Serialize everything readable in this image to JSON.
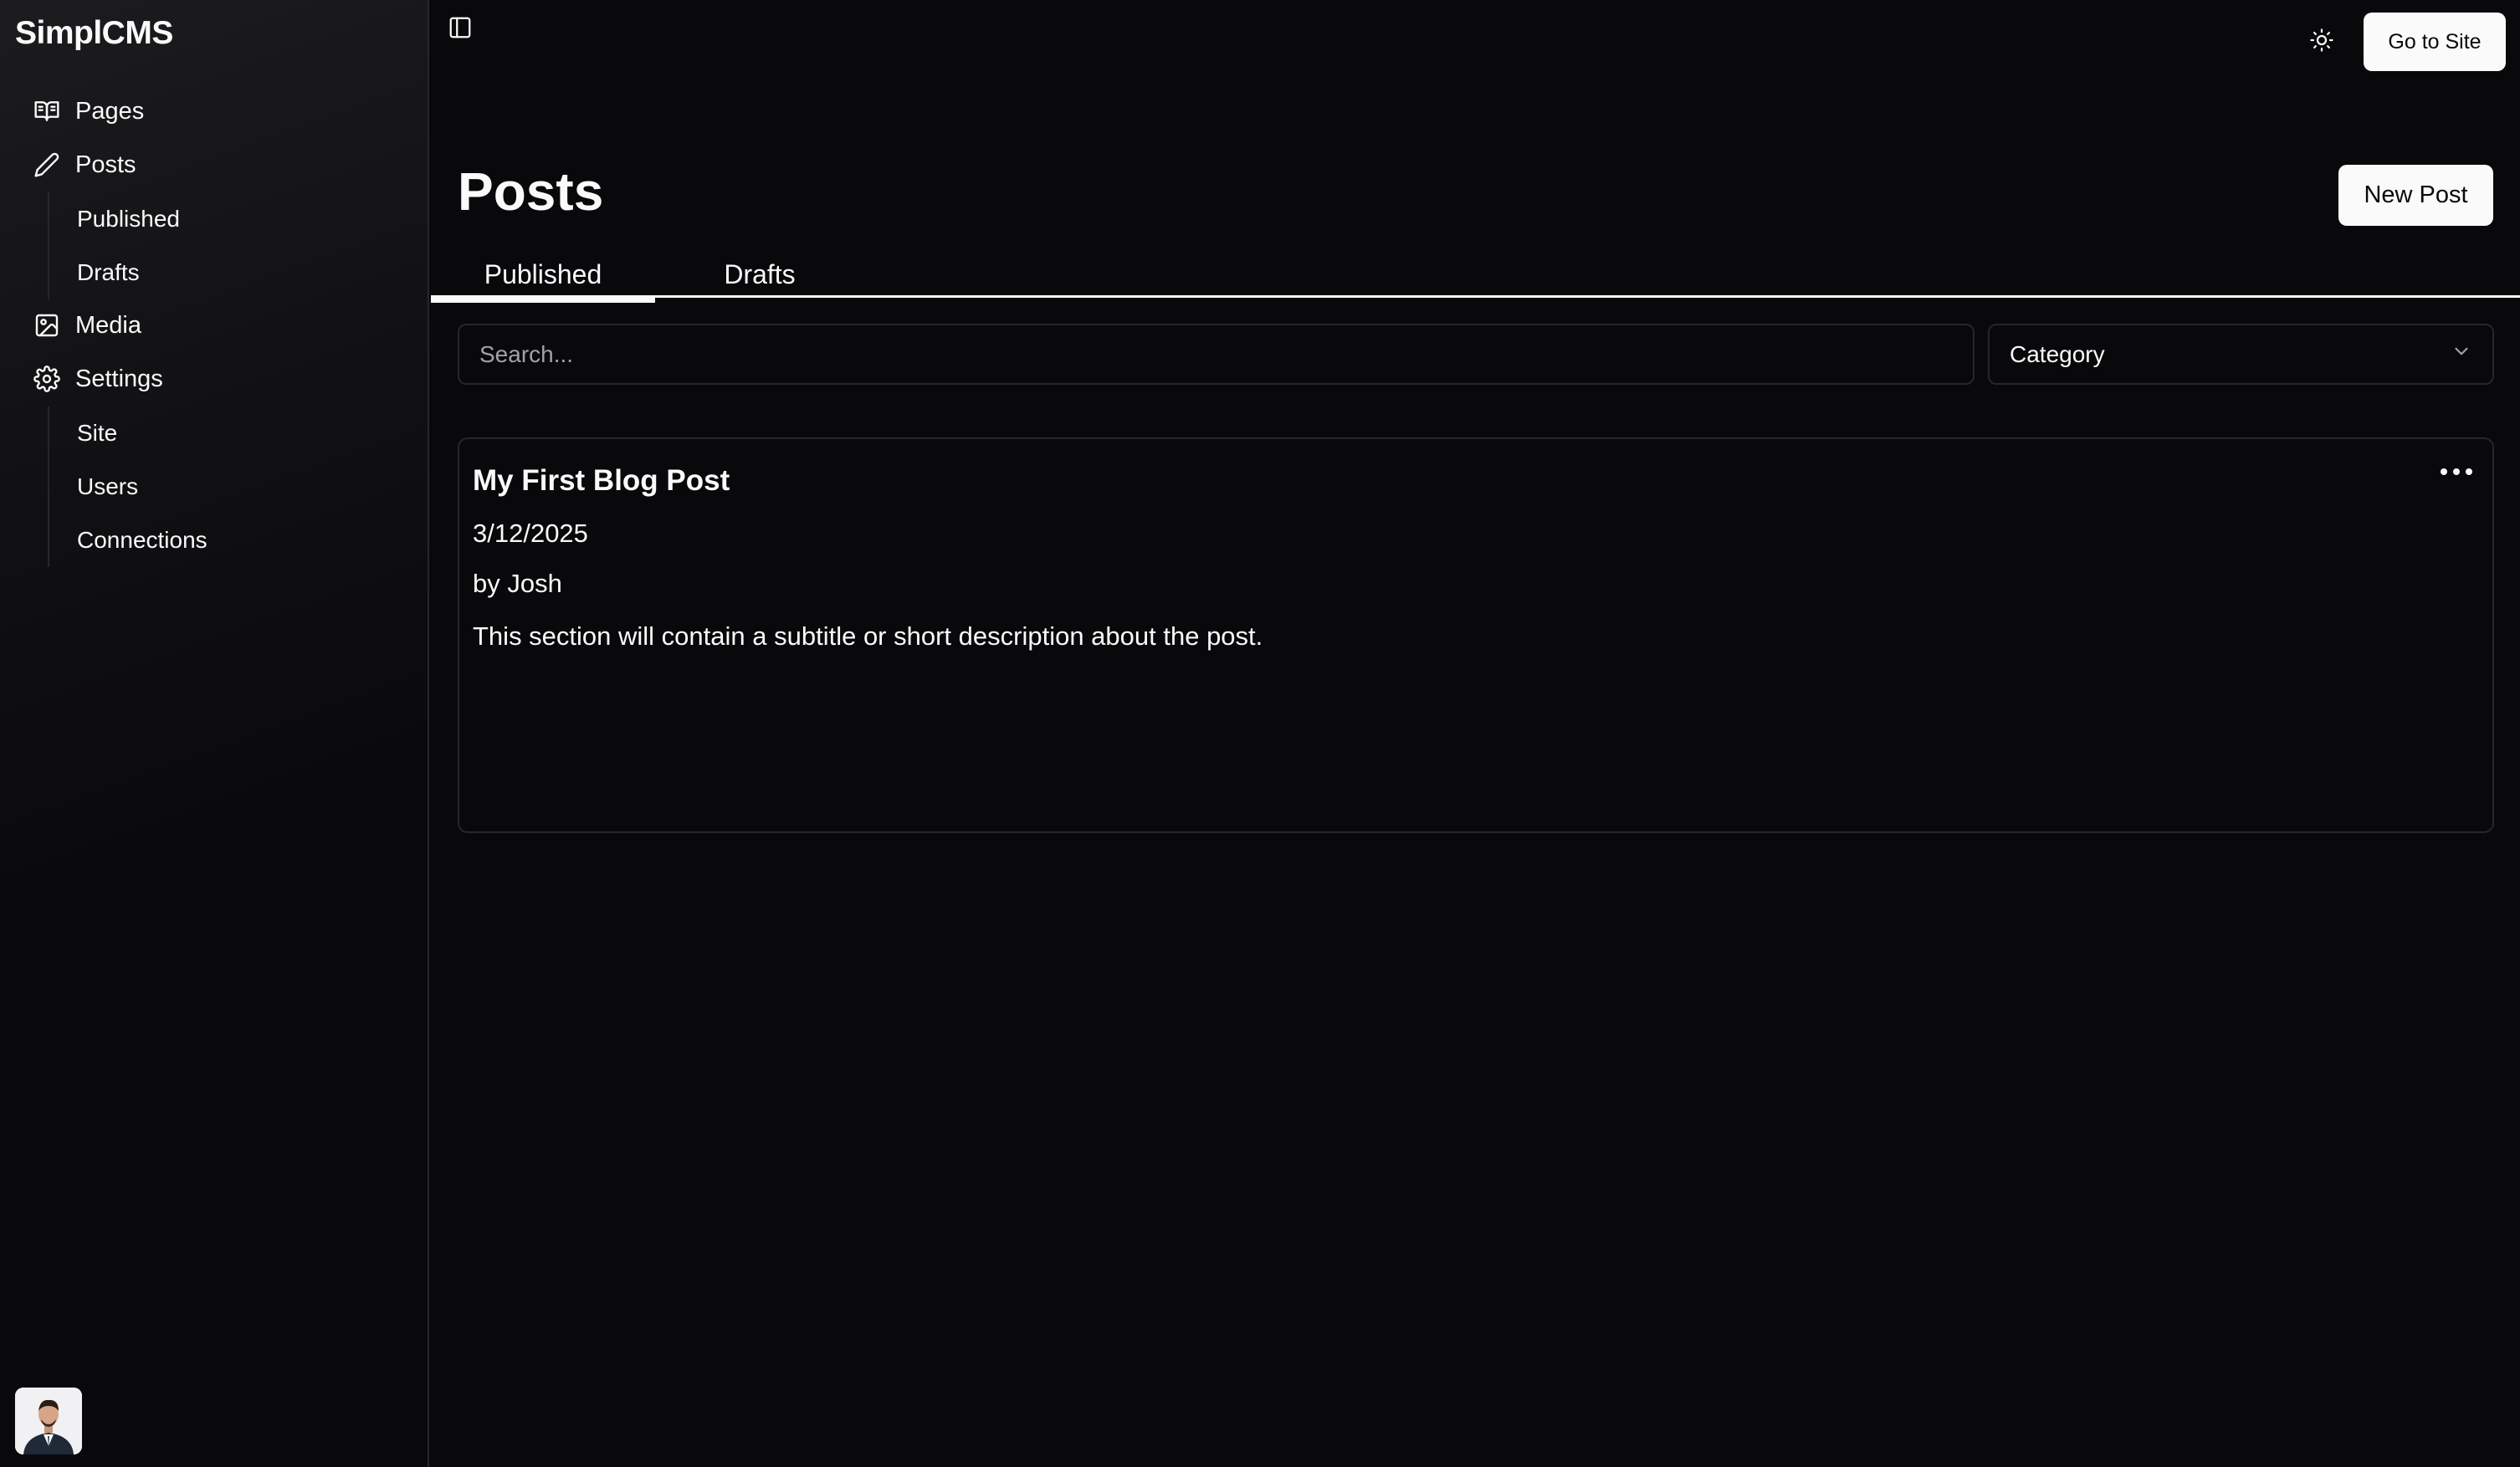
{
  "app": {
    "brand": "SimplCMS"
  },
  "sidebar": {
    "items": [
      {
        "label": "Pages",
        "icon": "book-open-icon"
      },
      {
        "label": "Posts",
        "icon": "pen-icon"
      },
      {
        "label": "Media",
        "icon": "image-icon"
      },
      {
        "label": "Settings",
        "icon": "gear-icon"
      }
    ],
    "posts_sub": [
      "Published",
      "Drafts"
    ],
    "settings_sub": [
      "Site",
      "Users",
      "Connections"
    ]
  },
  "header": {
    "go_to_site": "Go to Site",
    "theme_icon": "sun-icon",
    "sidebar_toggle_icon": "panel-left-icon"
  },
  "main": {
    "title": "Posts",
    "new_post": "New Post",
    "tabs": [
      {
        "label": "Published",
        "active": true
      },
      {
        "label": "Drafts",
        "active": false
      }
    ],
    "search": {
      "placeholder": "Search...",
      "value": ""
    },
    "category": {
      "label": "Category"
    },
    "posts": [
      {
        "title": "My First Blog Post",
        "date": "3/12/2025",
        "author": "by Josh",
        "description": "This section will contain a subtitle or short description about the post."
      }
    ]
  },
  "colors": {
    "background": "#09090b",
    "border": "#27272a",
    "foreground": "#fafafa",
    "muted": "#a1a1aa"
  }
}
